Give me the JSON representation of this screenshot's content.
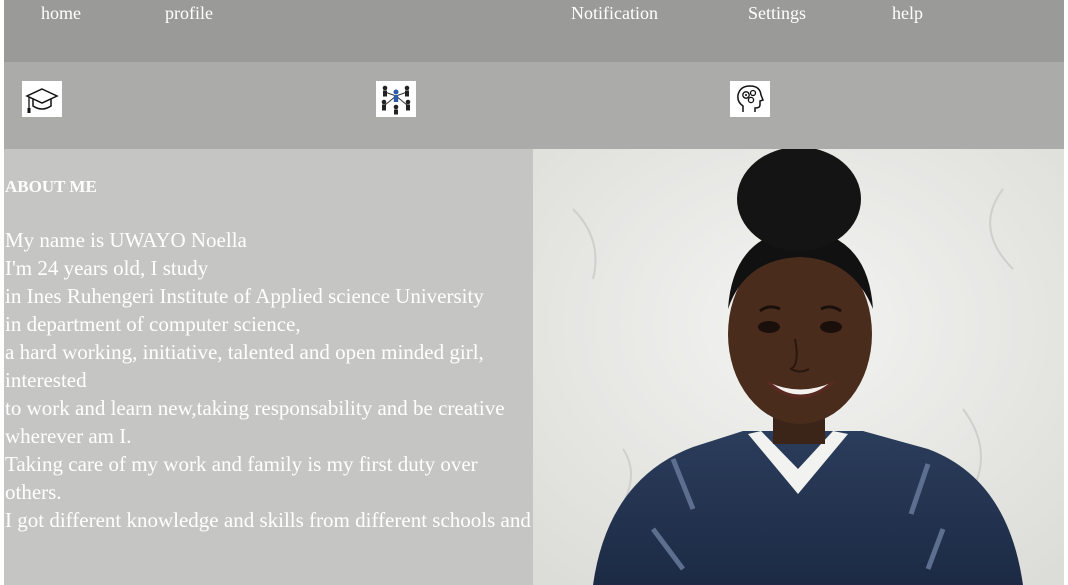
{
  "nav": {
    "home": "home",
    "profile": "profile",
    "notification": "Notification",
    "settings": "Settings",
    "help": "help"
  },
  "icons": [
    "graduation-cap-icon",
    "people-network-icon",
    "head-gears-icon"
  ],
  "about": {
    "title": "ABOUT ME",
    "lines": [
      "My name is UWAYO Noella",
      "I'm 24 years old, I study",
      "in Ines Ruhengeri Institute of Applied science University",
      "in department of computer science,",
      "a hard working, initiative, talented and open minded girl, interested",
      "to work and learn new,taking responsability and be creative wherever am I.",
      "Taking care of my work and family is my first duty over others.",
      "I got different knowledge and skills from different schools and"
    ]
  },
  "colors": {
    "nav_bg": "#9a9a99",
    "icon_bar_bg": "#ababaa",
    "about_bg": "#c5c5c3",
    "text": "#ffffff"
  }
}
